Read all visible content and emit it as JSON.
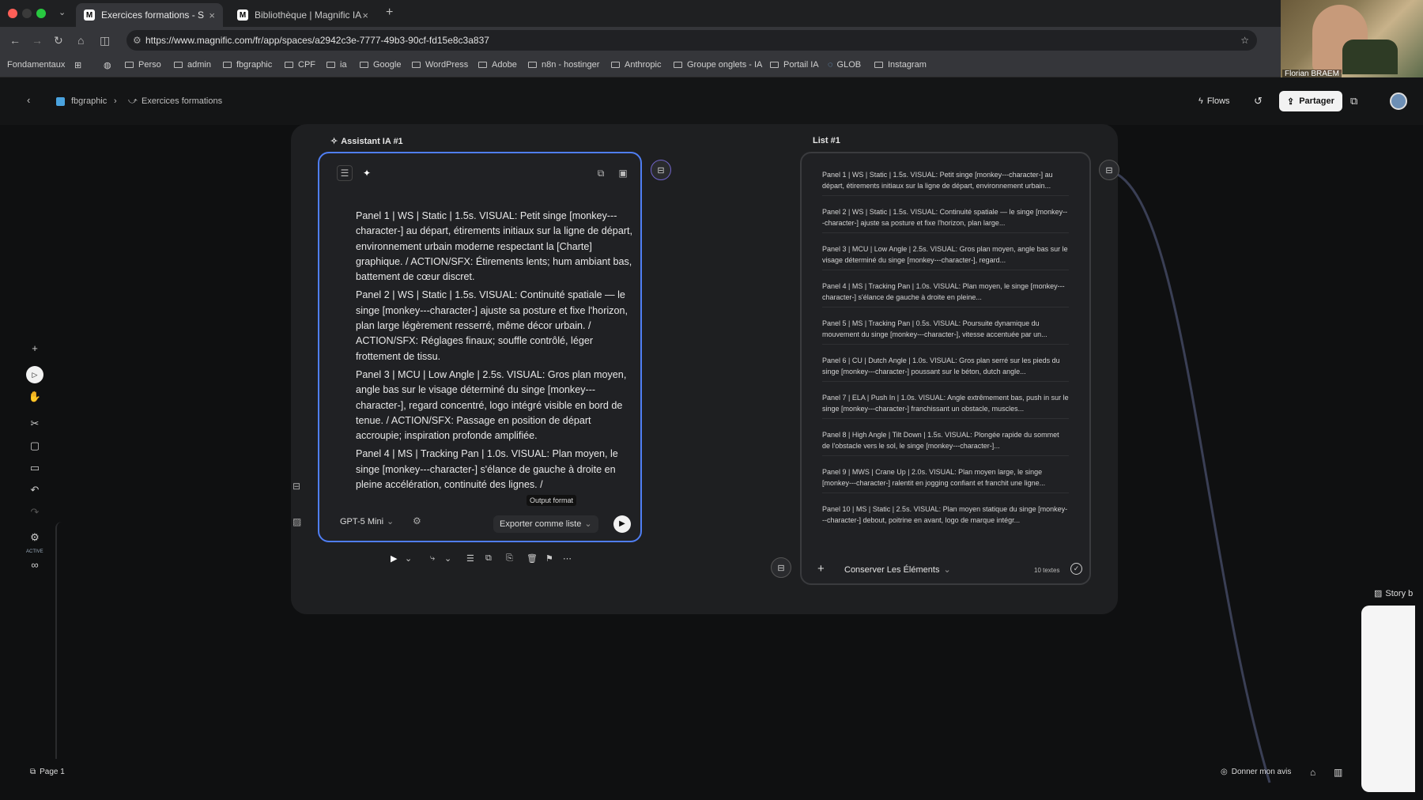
{
  "browser": {
    "tabs": [
      {
        "label": "Exercices formations - Space",
        "active": true
      },
      {
        "label": "Bibliothèque | Magnific IA",
        "active": false
      }
    ],
    "url": "https://www.magnific.com/fr/app/spaces/a2942c3e-7777-49b3-90cf-fd15e8c3a837",
    "bookmarks": [
      "Fondamentaux",
      "Perso",
      "admin",
      "fbgraphic",
      "CPF",
      "ia",
      "Google",
      "WordPress",
      "Adobe",
      "n8n - hostinger",
      "Anthropic",
      "Groupe onglets - IA",
      "Portail IA",
      "GLOB",
      "Instagram"
    ],
    "webcam_name": "Florian BRAEM"
  },
  "header": {
    "breadcrumb": [
      "fbgraphic",
      "Exercices formations"
    ],
    "flows_label": "Flows",
    "share_label": "Partager"
  },
  "assistant": {
    "title": "Assistant IA #1",
    "panels": [
      {
        "n": "1.",
        "text": "Panel 1 | WS | Static | 1.5s. VISUAL: Petit singe [monkey---character-] au départ, étirements initiaux sur la ligne de départ, environnement urbain moderne respectant la [Charte] graphique. / ACTION/SFX: Étirements lents; hum ambiant bas, battement de cœur discret."
      },
      {
        "n": "2.",
        "text": "Panel 2 | WS | Static | 1.5s. VISUAL: Continuité spatiale — le singe [monkey---character-] ajuste sa posture et fixe l'horizon, plan large légèrement resserré, même décor urbain. / ACTION/SFX: Réglages finaux; souffle contrôlé, léger frottement de tissu."
      },
      {
        "n": "3.",
        "text": "Panel 3 | MCU | Low Angle | 2.5s. VISUAL: Gros plan moyen, angle bas sur le visage déterminé du singe [monkey---character-], regard concentré, logo intégré visible en bord de tenue. / ACTION/SFX: Passage en position de départ accroupie; inspiration profonde amplifiée."
      },
      {
        "n": "4.",
        "text": "Panel 4 | MS | Tracking Pan | 1.0s. VISUAL: Plan moyen, le singe [monkey---character-] s'élance de gauche à droite en pleine accélération, continuité des lignes. /"
      }
    ],
    "tooltip": "Output format",
    "model_label": "GPT-5 Mini",
    "export_label": "Exporter comme liste"
  },
  "list": {
    "title": "List #1",
    "items": [
      "Panel 1 | WS | Static | 1.5s. VISUAL: Petit singe [monkey---character-] au départ, étirements initiaux sur la ligne de départ, environnement urbain...",
      "Panel 2 | WS | Static | 1.5s. VISUAL: Continuité spatiale — le singe [monkey---character-] ajuste sa posture et fixe l'horizon, plan large...",
      "Panel 3 | MCU | Low Angle | 2.5s. VISUAL: Gros plan moyen, angle bas sur le visage déterminé du singe [monkey---character-], regard...",
      "Panel 4 | MS | Tracking Pan | 1.0s. VISUAL: Plan moyen, le singe [monkey---character-] s'élance de gauche à droite en pleine...",
      "Panel 5 | MS | Tracking Pan | 0.5s. VISUAL: Poursuite dynamique du mouvement du singe [monkey---character-], vitesse accentuée par un...",
      "Panel 6 | CU | Dutch Angle | 1.0s. VISUAL: Gros plan serré sur les pieds du singe [monkey---character-] poussant sur le béton, dutch angle...",
      "Panel 7 | ELA | Push In | 1.0s. VISUAL: Angle extrêmement bas, push in sur le singe [monkey---character-] franchissant un obstacle, muscles...",
      "Panel 8 | High Angle | Tilt Down | 1.5s. VISUAL: Plongée rapide du sommet de l'obstacle vers le sol, le singe [monkey---character-]...",
      "Panel 9 | MWS | Crane Up | 2.0s. VISUAL: Plan moyen large, le singe [monkey---character-] ralentit en jogging confiant et franchit une ligne...",
      "Panel 10 | MS | Static | 2.5s. VISUAL: Plan moyen statique du singe [monkey---character-] debout, poitrine en avant, logo de marque intégr..."
    ],
    "keep_label": "Conserver Les Éléments",
    "count_label": "10 textes"
  },
  "left_toolbar": {
    "active_label": "ACTIVE"
  },
  "footer": {
    "page_label": "Page 1",
    "feedback_label": "Donner mon avis",
    "story_label": "Story b"
  },
  "colors": {
    "accent": "#4f7ef3",
    "edge": "#7f6ee0",
    "board": "#1e1f21",
    "canvas": "#0f1011"
  }
}
